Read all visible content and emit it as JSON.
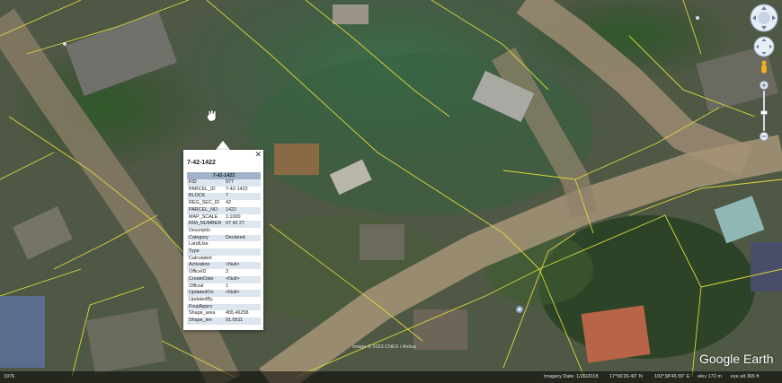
{
  "imagery": {
    "copyright": "Image © 2023 CNES / Airbus",
    "logo": "Google Earth"
  },
  "status": {
    "left_label": "1976",
    "imagery_date": "Imagery Date: 1/26/2018",
    "latitude": "17°56'26.40\" N",
    "longitude": "102°38'46.55\" E",
    "elevation": "elev  172 m",
    "eye_alt": "eye alt  365 ft"
  },
  "balloon": {
    "title": "7-42-1422",
    "header": "7-42-1422",
    "close_glyph": "✕",
    "rows": [
      {
        "key": "FID",
        "value": "977"
      },
      {
        "key": "PARCEL_ID",
        "value": "7-42-1422"
      },
      {
        "key": "BLOCK",
        "value": "7"
      },
      {
        "key": "REG_SEC_ID",
        "value": "42"
      },
      {
        "key": "PARCEL_NO",
        "value": "1422"
      },
      {
        "key": "MAP_SCALE",
        "value": "1:1000"
      },
      {
        "key": "RIM_NUMBER",
        "value": "07 42 27"
      },
      {
        "key": "Descriptio",
        "value": ""
      },
      {
        "key": "Category",
        "value": "Declared"
      },
      {
        "key": "LandUse",
        "value": ""
      },
      {
        "key": "Type",
        "value": ""
      },
      {
        "key": "Calculated",
        "value": ""
      },
      {
        "key": "Activation",
        "value": "<Null>"
      },
      {
        "key": "OfficeID",
        "value": "3"
      },
      {
        "key": "CreateDate",
        "value": "<Null>"
      },
      {
        "key": "Official",
        "value": "1"
      },
      {
        "key": "UpdatedOn",
        "value": "<Null>"
      },
      {
        "key": "UpdatedBy",
        "value": ""
      },
      {
        "key": "FinalAppro",
        "value": ""
      },
      {
        "key": "Shape_area",
        "value": "455.46258"
      },
      {
        "key": "Shape_len",
        "value": "91.0511"
      }
    ]
  },
  "controls": {
    "look_icon": "look-joystick-icon",
    "move_icon": "move-joystick-icon",
    "pegman_icon": "street-view-pegman-icon",
    "zoom_in_glyph": "+",
    "zoom_out_glyph": "−",
    "zoom_level": 0.55
  },
  "colors": {
    "parcel_line": "#e3df3a",
    "balloon_header": "#9fb2c9",
    "row_alt": "#dde5ef"
  }
}
